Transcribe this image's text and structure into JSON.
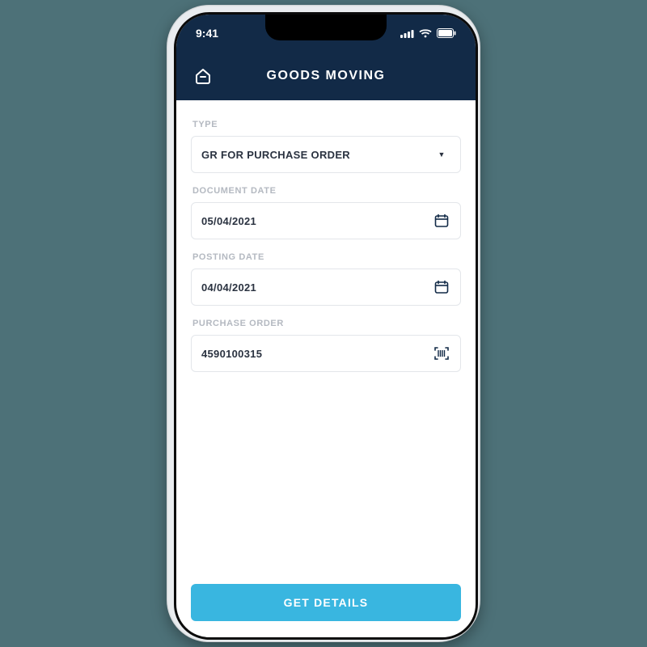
{
  "status": {
    "time": "9:41"
  },
  "header": {
    "title": "GOODS MOVING"
  },
  "form": {
    "type": {
      "label": "TYPE",
      "value": "GR FOR PURCHASE ORDER"
    },
    "documentDate": {
      "label": "DOCUMENT DATE",
      "value": "05/04/2021"
    },
    "postingDate": {
      "label": "POSTING DATE",
      "value": "04/04/2021"
    },
    "purchaseOrder": {
      "label": "PURCHASE ORDER",
      "value": "4590100315"
    }
  },
  "footer": {
    "getDetails": "GET DETAILS"
  }
}
